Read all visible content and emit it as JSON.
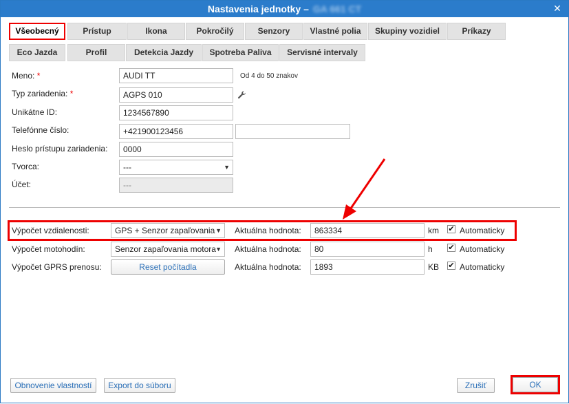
{
  "window": {
    "title": "Nastavenia jednotky –",
    "title_suffix": "GA 661 CT",
    "close_label": "✕"
  },
  "tabs_row1": [
    "Všeobecný",
    "Prístup",
    "Ikona",
    "Pokročilý",
    "Senzory",
    "Vlastné polia",
    "Skupiny vozidiel",
    "Príkazy"
  ],
  "tabs_row2": [
    "Eco Jazda",
    "Profil",
    "Detekcia Jazdy",
    "Spotreba Paliva",
    "Servisné intervaly"
  ],
  "form": {
    "name_label": "Meno:",
    "name_value": "AUDI TT",
    "name_hint": "Od 4 do 50 znakov",
    "device_type_label": "Typ zariadenia:",
    "device_type_value": "AGPS 010",
    "unique_id_label": "Unikátne ID:",
    "unique_id_value": "1234567890",
    "phone_label": "Telefónne číslo:",
    "phone_value": "+421900123456",
    "phone2_value": "",
    "password_label": "Heslo prístupu zariadenia:",
    "password_value": "0000",
    "creator_label": "Tvorca:",
    "creator_value": "---",
    "account_label": "Účet:",
    "account_value": "---",
    "required_mark": "*"
  },
  "counters": {
    "distance_label": "Výpočet vzdialenosti:",
    "distance_select": "GPS + Senzor zapaľovania",
    "distance_current_label": "Aktuálna hodnota:",
    "distance_value": "863334",
    "distance_unit": "km",
    "engine_label": "Výpočet motohodín:",
    "engine_select": "Senzor zapaľovania motora",
    "engine_current_label": "Aktuálna hodnota:",
    "engine_value": "80",
    "engine_unit": "h",
    "gprs_label": "Výpočet GPRS prenosu:",
    "gprs_reset": "Reset počítadla",
    "gprs_current_label": "Aktuálna hodnota:",
    "gprs_value": "1893",
    "gprs_unit": "KB",
    "auto_label": "Automaticky",
    "check_mark": "✔"
  },
  "footer": {
    "restore_props": "Obnovenie vlastností",
    "export_file": "Export do súboru",
    "cancel": "Zrušiť",
    "ok": "OK"
  },
  "colors": {
    "title_bg": "#2b7ccb",
    "highlight": "#e00000",
    "link": "#2a6fb7"
  }
}
